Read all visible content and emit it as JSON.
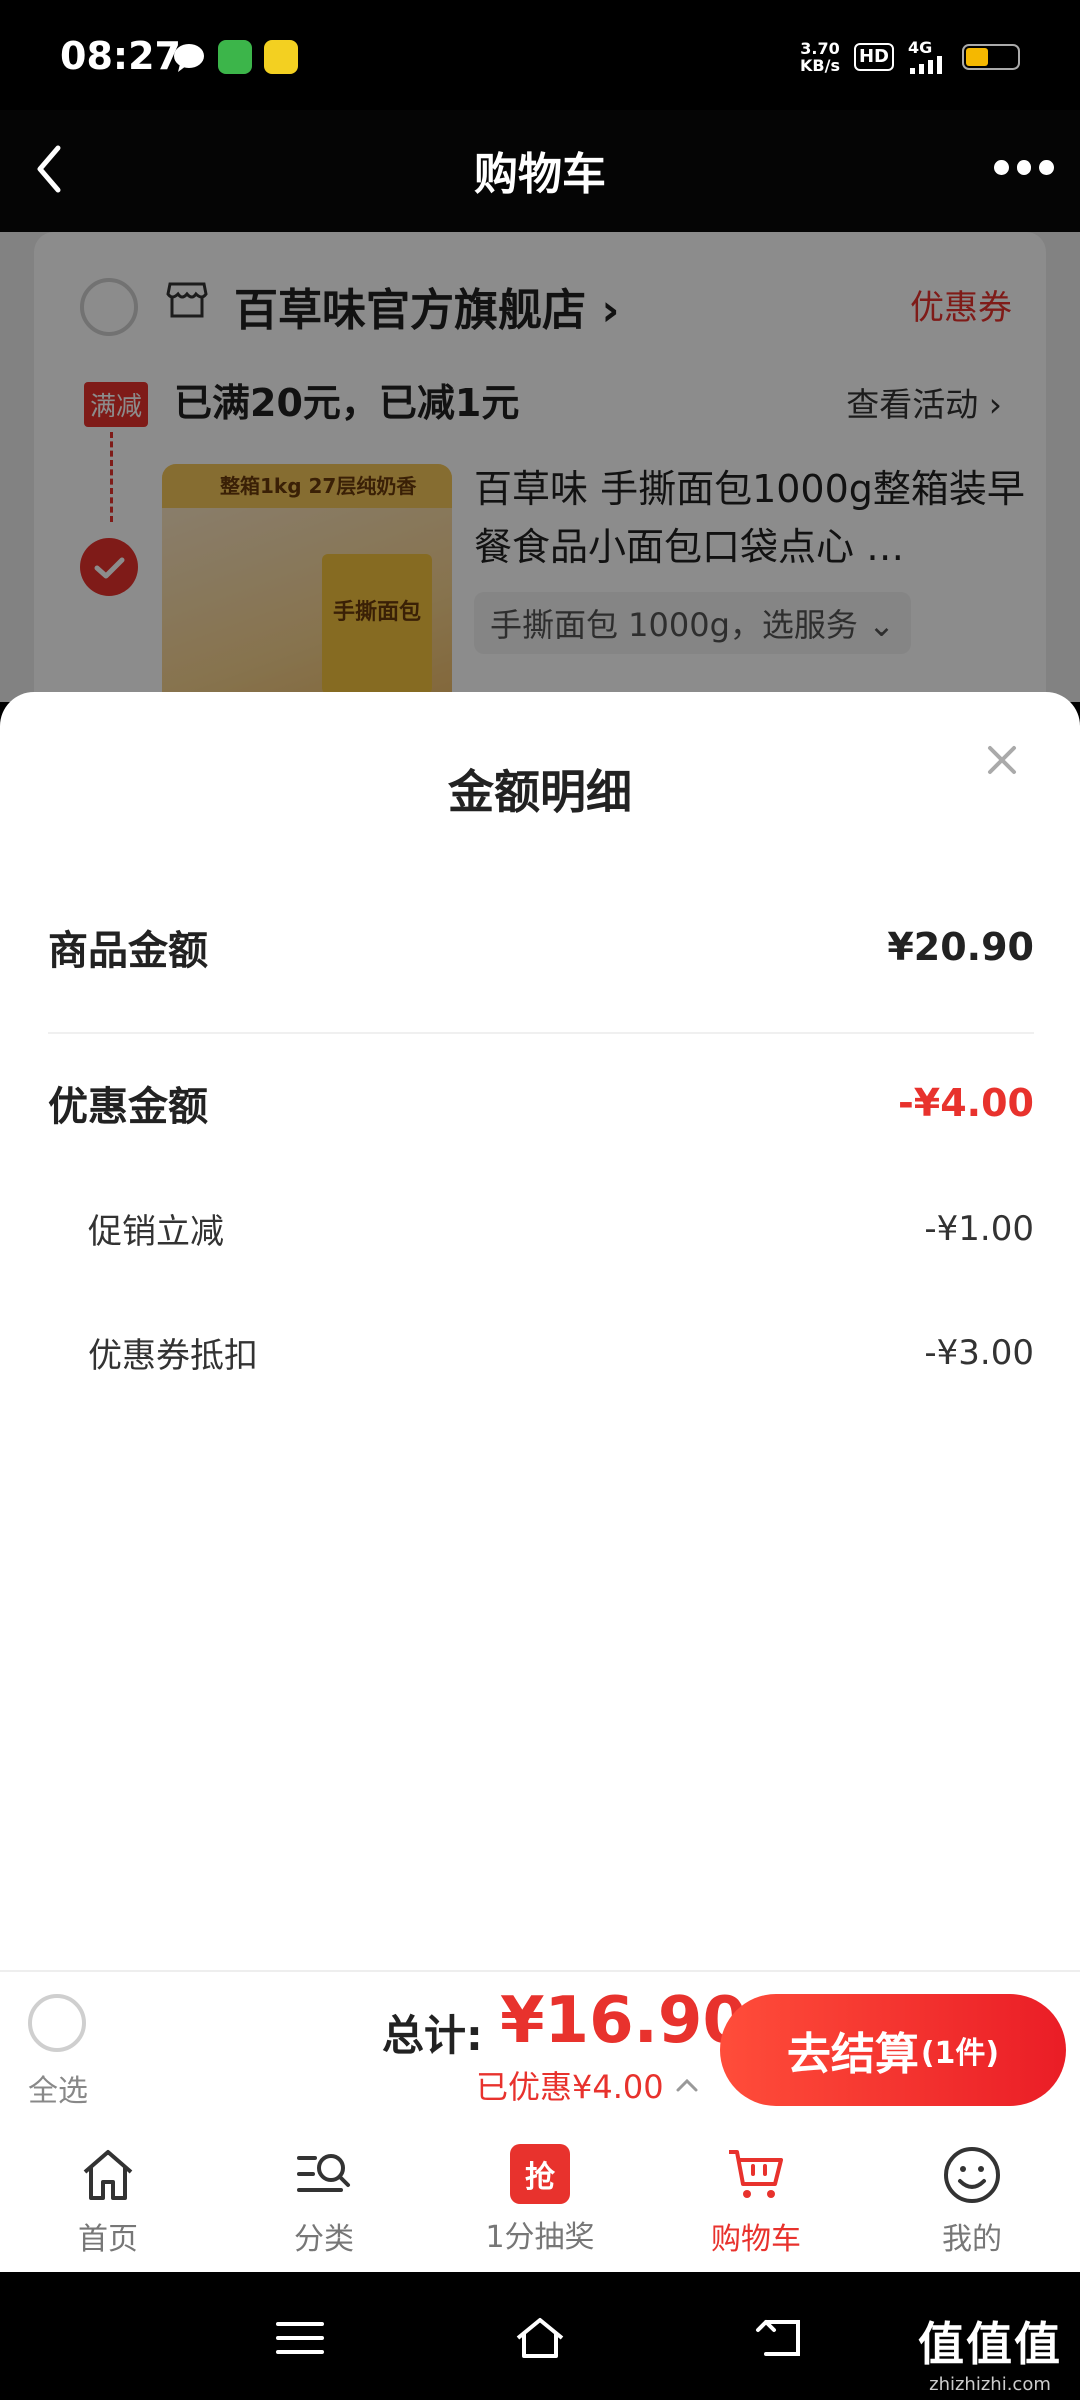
{
  "status_bar": {
    "time": "08:27",
    "net_speed_value": "3.70",
    "net_speed_unit": "KB/s",
    "hd_label": "HD",
    "signal_label": "4G"
  },
  "header": {
    "title": "购物车"
  },
  "store": {
    "name": "百草味官方旗舰店",
    "coupon_link": "优惠券",
    "promo_tag": "满减",
    "promo_text": "已满20元，已减1元",
    "promo_link": "查看活动"
  },
  "product": {
    "title": "百草味 手撕面包1000g整箱装早餐食品小面包口袋点心 …",
    "spec": "手撕面包 1000g，选服务",
    "image_band_text": "整箱1kg 27层纯奶香",
    "image_box_text": "手撕面包"
  },
  "sheet": {
    "title": "金额明细",
    "goods_label": "商品金额",
    "goods_value": "¥20.90",
    "discount_label": "优惠金额",
    "discount_value": "-¥4.00",
    "promo_label": "促销立减",
    "promo_value": "-¥1.00",
    "coupon_label": "优惠券抵扣",
    "coupon_value": "-¥3.00"
  },
  "checkout": {
    "select_all": "全选",
    "total_label": "总计:",
    "total_value": "¥16.90",
    "saved_text": "已优惠¥4.00",
    "button_label": "去结算",
    "button_count": "(1件)"
  },
  "tabs": [
    {
      "label": "首页",
      "icon": "home-icon"
    },
    {
      "label": "分类",
      "icon": "category-search-icon"
    },
    {
      "label": "1分抽奖",
      "icon": "grab-icon",
      "icon_text": "抢"
    },
    {
      "label": "购物车",
      "icon": "cart-icon",
      "active": true
    },
    {
      "label": "我的",
      "icon": "smiley-icon"
    }
  ],
  "watermark": {
    "big": "值值值",
    "small": "zhizhizhi.com"
  },
  "colors": {
    "accent": "#e8322d",
    "sheet_bg": "#ffffff",
    "header_bg": "#050505"
  }
}
